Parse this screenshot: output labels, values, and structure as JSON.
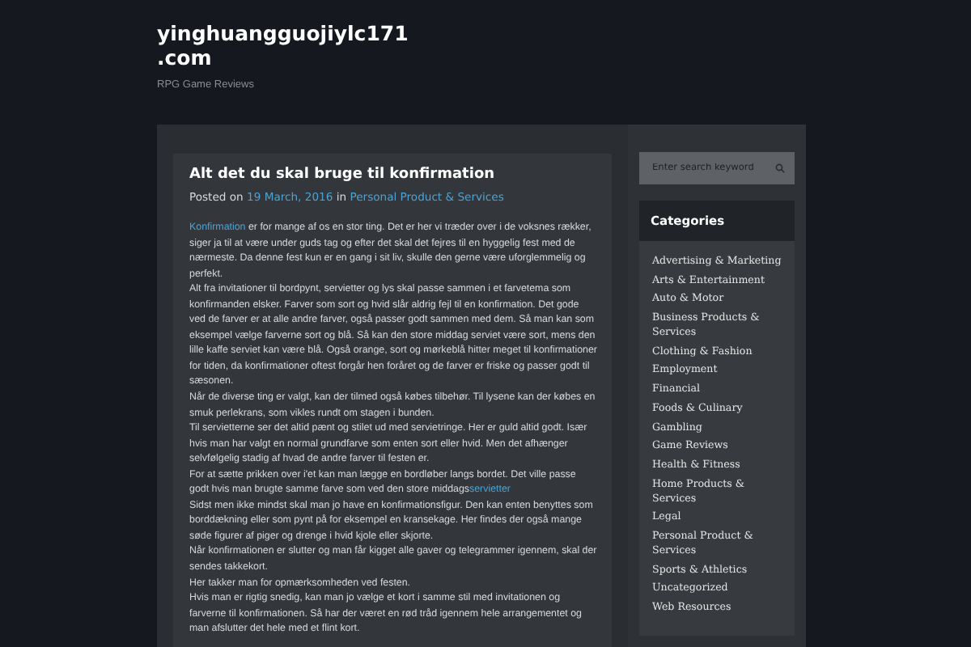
{
  "site": {
    "title_lines": [
      "yinghuangguojiylc171",
      ".com"
    ],
    "tagline": "RPG Game Reviews"
  },
  "post": {
    "title": "Alt det du skal bruge til konfirmation",
    "meta": {
      "posted_on": "Posted on",
      "date": "19 March, 2016",
      "in": "in",
      "category": "Personal Product & Services"
    },
    "paragraphs": [
      [
        {
          "kind": "link",
          "text": "Konfirmation"
        },
        {
          "kind": "text",
          "text": " er for mange af os en stor ting. Det er her vi træder over i de voksnes rækker, siger ja til at være under guds tag og efter det skal det fejres til en hyggelig fest med de nærmeste. Da denne fest kun er en gang i sit liv, skulle den gerne være uforglemmelig og perfekt."
        }
      ],
      [
        {
          "kind": "text",
          "text": "Alt fra invitationer til bordpynt, servietter og lys skal passe sammen i et farvetema som konfirmanden elsker. Farver som sort og hvid slår aldrig fejl til en konfirmation.  Det gode ved de farver er at alle andre farver, også passer godt sammen med dem. Så man kan som eksempel vælge farverne sort og blå. Så kan den store middag serviet være sort, mens den lille kaffe serviet kan være blå. Også orange, sort og mørkeblå hitter meget til konfirmationer for tiden, da konfirmationer oftest forgår hen foråret og de farver er friske og passer godt til sæsonen."
        }
      ],
      [
        {
          "kind": "text",
          "text": "Når de diverse ting er valgt, kan der tilmed også købes tilbehør. Til lysene kan der købes en smuk perlekrans, som vikles rundt om stagen i bunden."
        }
      ],
      [
        {
          "kind": "text",
          "text": "Til servietterne ser det altid pænt og stilet ud med servietringe. Her er guld altid godt. Især hvis man har valgt en normal grundfarve som enten sort eller hvid.  Men det afhænger selvfølgelig stadig af hvad de andre farver til festen er."
        }
      ],
      [
        {
          "kind": "text",
          "text": "For at sætte prikken over i'et kan man lægge en bordløber langs bordet. Det ville passe godt hvis man brugte samme farve som ved den store middags"
        },
        {
          "kind": "link",
          "text": "servietter"
        }
      ],
      [
        {
          "kind": "text",
          "text": "Sidst men ikke mindst skal man jo have en konfirmationsfigur. Den kan enten benyttes som borddækning eller som pynt på for eksempel en kransekage. Her findes der også mange søde figurer af piger og drenge i hvid kjole eller skjorte."
        }
      ],
      [
        {
          "kind": "text",
          "text": "Når konfirmationen er slutter og man får kigget alle gaver og telegrammer igennem, skal der sendes takkekort."
        }
      ],
      [
        {
          "kind": "text",
          "text": "Her takker man for opmærksomheden ved festen."
        }
      ],
      [
        {
          "kind": "text",
          "text": "Hvis man er rigtig snedig, kan man jo vælge et kort i samme stil med invitationen og farverne til konfirmationen. Så har der været en rød tråd igennem hele arrangementet og man afslutter det hele med et flint kort."
        }
      ]
    ]
  },
  "sidebar": {
    "search": {
      "placeholder": "Enter search keyword"
    },
    "categories": {
      "title": "Categories",
      "items": [
        "Advertising & Marketing",
        "Arts & Entertainment",
        "Auto & Motor",
        "Business Products & Services",
        "Clothing & Fashion",
        "Employment",
        "Financial",
        "Foods & Culinary",
        "Gambling",
        "Game Reviews",
        "Health & Fitness",
        "Home Products & Services",
        "Legal",
        "Personal Product & Services",
        "Sports & Athletics",
        "Uncategorized",
        "Web Resources"
      ]
    }
  }
}
